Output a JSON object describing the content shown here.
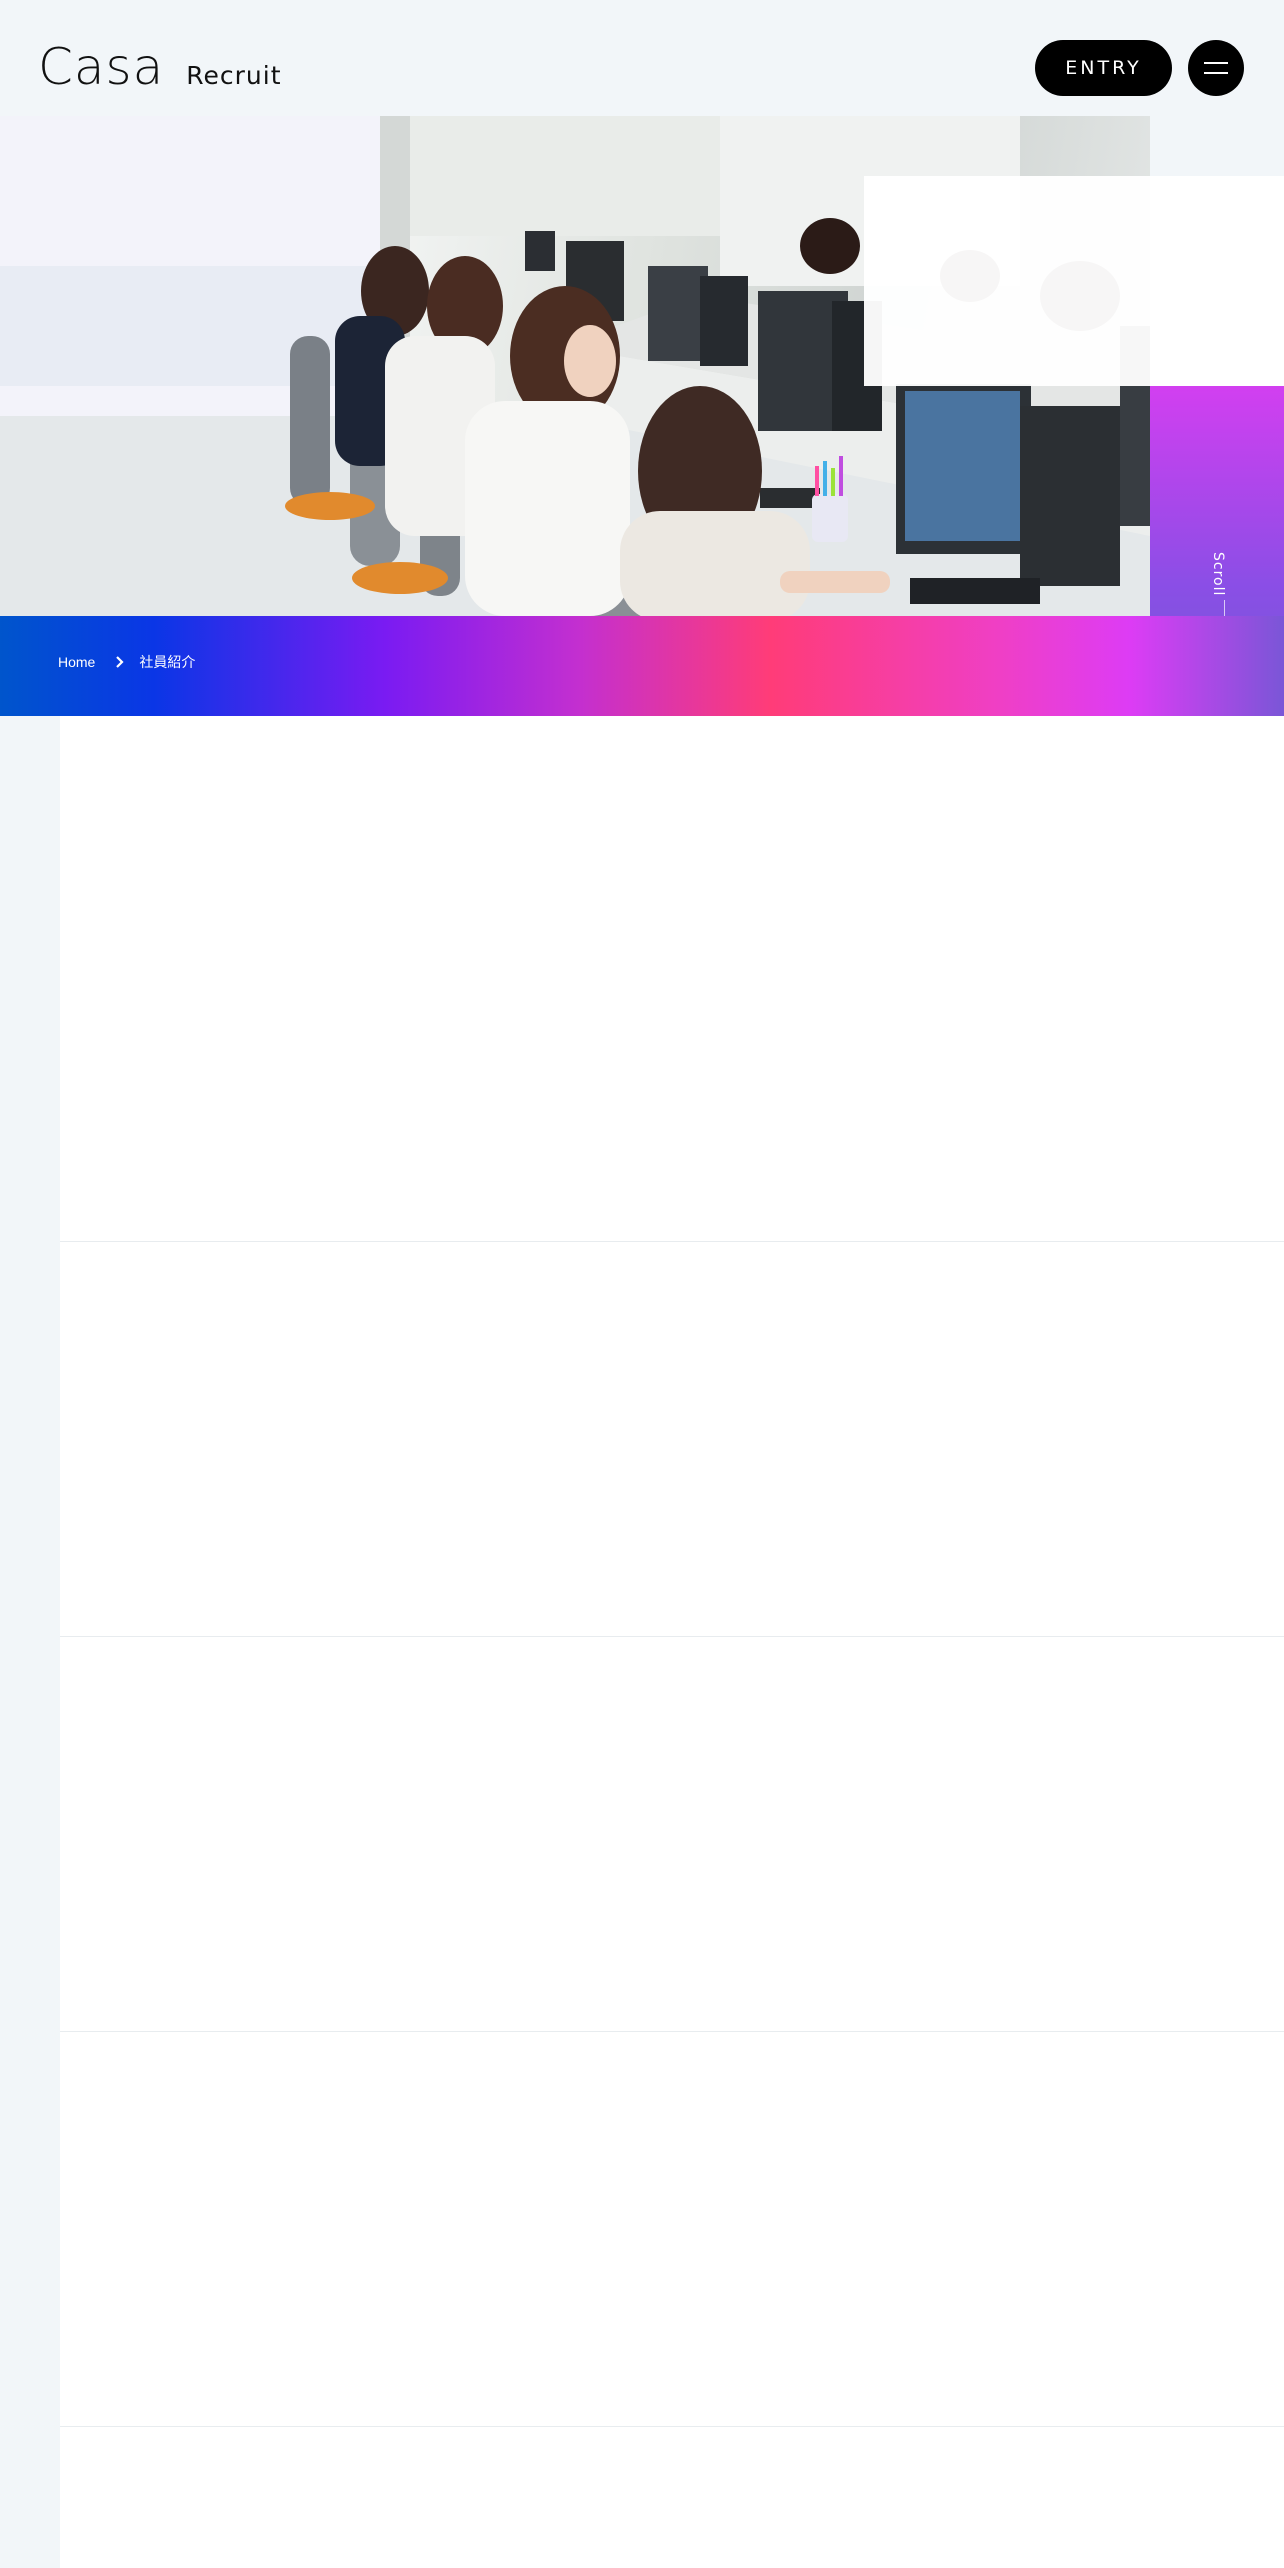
{
  "header": {
    "logo_main": "Casa",
    "logo_sub": "Recruit",
    "entry_label": "ENTRY",
    "menu_icon": "hamburger-icon"
  },
  "hero": {
    "image_alt": "オフィスで働く社員",
    "scroll_label": "Scroll"
  },
  "breadcrumb": {
    "home": "Home",
    "separator_icon": "chevron-right-icon",
    "current": "社員紹介"
  },
  "colors": {
    "page_bg": "#f2f6f9",
    "gradient_start": "#0055cc",
    "gradient_mid": "#ff3c78",
    "gradient_end": "#7a56d7",
    "button_bg": "#000000"
  }
}
